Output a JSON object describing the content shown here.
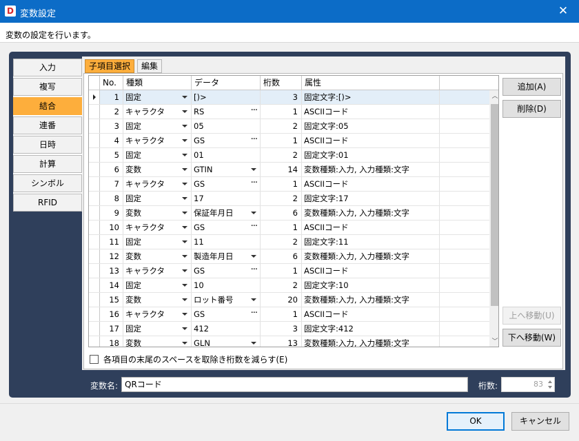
{
  "window": {
    "title": "変数設定",
    "app_icon": "D",
    "subtitle": "変数の設定を行います。"
  },
  "sidebar": {
    "items": [
      {
        "label": "入力",
        "active": false
      },
      {
        "label": "複写",
        "active": false
      },
      {
        "label": "結合",
        "active": true
      },
      {
        "label": "連番",
        "active": false
      },
      {
        "label": "日時",
        "active": false
      },
      {
        "label": "計算",
        "active": false
      },
      {
        "label": "シンボル",
        "active": false
      },
      {
        "label": "RFID",
        "active": false
      }
    ]
  },
  "tabs": [
    {
      "label": "子項目選択",
      "active": true
    },
    {
      "label": "編集",
      "active": false
    }
  ],
  "grid": {
    "headers": [
      "No.",
      "種類",
      "データ",
      "桁数",
      "属性"
    ],
    "rows": [
      {
        "no": "1",
        "kind": "固定",
        "data": "[)>",
        "data_mode": "text",
        "digits": "3",
        "attr": "固定文字:[)>",
        "selected": true
      },
      {
        "no": "2",
        "kind": "キャラクタ",
        "data": "RS",
        "data_mode": "dots",
        "digits": "1",
        "attr": "ASCIIコード"
      },
      {
        "no": "3",
        "kind": "固定",
        "data": "05",
        "data_mode": "text",
        "digits": "2",
        "attr": "固定文字:05"
      },
      {
        "no": "4",
        "kind": "キャラクタ",
        "data": "GS",
        "data_mode": "dots",
        "digits": "1",
        "attr": "ASCIIコード"
      },
      {
        "no": "5",
        "kind": "固定",
        "data": "01",
        "data_mode": "text",
        "digits": "2",
        "attr": "固定文字:01"
      },
      {
        "no": "6",
        "kind": "変数",
        "data": "GTIN",
        "data_mode": "dropdown",
        "digits": "14",
        "attr": "変数種類:入力, 入力種類:文字"
      },
      {
        "no": "7",
        "kind": "キャラクタ",
        "data": "GS",
        "data_mode": "dots",
        "digits": "1",
        "attr": "ASCIIコード"
      },
      {
        "no": "8",
        "kind": "固定",
        "data": "17",
        "data_mode": "text",
        "digits": "2",
        "attr": "固定文字:17"
      },
      {
        "no": "9",
        "kind": "変数",
        "data": "保証年月日",
        "data_mode": "dropdown",
        "digits": "6",
        "attr": "変数種類:入力, 入力種類:文字"
      },
      {
        "no": "10",
        "kind": "キャラクタ",
        "data": "GS",
        "data_mode": "dots",
        "digits": "1",
        "attr": "ASCIIコード"
      },
      {
        "no": "11",
        "kind": "固定",
        "data": "11",
        "data_mode": "text",
        "digits": "2",
        "attr": "固定文字:11"
      },
      {
        "no": "12",
        "kind": "変数",
        "data": "製造年月日",
        "data_mode": "dropdown",
        "digits": "6",
        "attr": "変数種類:入力, 入力種類:文字"
      },
      {
        "no": "13",
        "kind": "キャラクタ",
        "data": "GS",
        "data_mode": "dots",
        "digits": "1",
        "attr": "ASCIIコード"
      },
      {
        "no": "14",
        "kind": "固定",
        "data": "10",
        "data_mode": "text",
        "digits": "2",
        "attr": "固定文字:10"
      },
      {
        "no": "15",
        "kind": "変数",
        "data": "ロット番号",
        "data_mode": "dropdown",
        "digits": "20",
        "attr": "変数種類:入力, 入力種類:文字"
      },
      {
        "no": "16",
        "kind": "キャラクタ",
        "data": "GS",
        "data_mode": "dots",
        "digits": "1",
        "attr": "ASCIIコード"
      },
      {
        "no": "17",
        "kind": "固定",
        "data": "412",
        "data_mode": "text",
        "digits": "3",
        "attr": "固定文字:412"
      },
      {
        "no": "18",
        "kind": "変数",
        "data": "GLN",
        "data_mode": "dropdown",
        "digits": "13",
        "attr": "変数種類:入力, 入力種類:文字"
      }
    ]
  },
  "buttons": {
    "add": "追加(A)",
    "delete": "削除(D)",
    "move_up": "上へ移動(U)",
    "move_down": "下へ移動(W)"
  },
  "checkbox": {
    "label": "各項目の末尾のスペースを取除き桁数を減らす(E)",
    "checked": false
  },
  "variable_name": {
    "label": "変数名:",
    "value": "QRコード"
  },
  "digits_field": {
    "label": "桁数:",
    "value": "83"
  },
  "footer": {
    "ok": "OK",
    "cancel": "キャンセル"
  },
  "colors": {
    "titlebar": "#0c6cc7",
    "accent": "#fdae3c",
    "frame": "#2f3f5b"
  }
}
